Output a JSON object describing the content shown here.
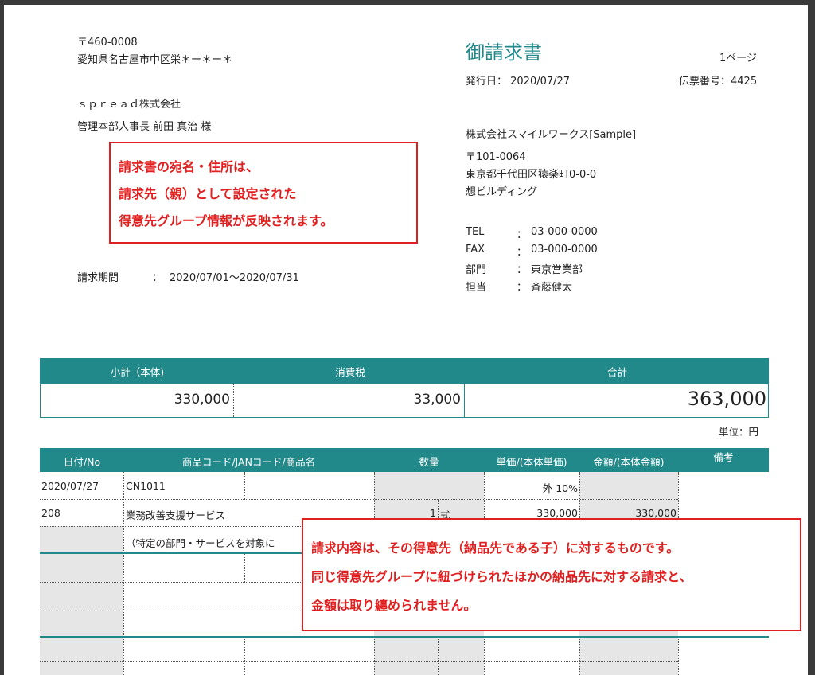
{
  "recipient": {
    "postal": "〒460-0008",
    "address": "愛知県名古屋市中区栄＊ー＊ー＊",
    "company": "ｓｐｒｅａｄ株式会社",
    "person": "管理本部人事長 前田 真治 様"
  },
  "header": {
    "title": "御請求書",
    "page": "1ページ",
    "issue_date": "発行日： 2020/07/27",
    "slip_no": "伝票番号：4425"
  },
  "issuer": {
    "company": "株式会社スマイルワークス[Sample]",
    "postal": "〒101-0064",
    "address": "東京都千代田区猿楽町0-0-0",
    "building": "想ビルディング",
    "rows": [
      {
        "label": "TEL",
        "sep": "：",
        "value": "03-000-0000"
      },
      {
        "label": "FAX",
        "sep": "：",
        "value": "03-000-0000"
      },
      {
        "label": "部門",
        "sep": "：",
        "value": "東京営業部"
      },
      {
        "label": "担当",
        "sep": "：",
        "value": "斉藤健太"
      }
    ]
  },
  "period": {
    "label": "請求期間",
    "sep": "：",
    "value": "2020/07/01〜2020/07/31"
  },
  "callout1": {
    "lines": [
      "請求書の宛名・住所は、",
      "請求先（親）として設定された",
      "得意先グループ情報が反映されます。"
    ]
  },
  "totals": {
    "headers": [
      "小計（本体)",
      "消費税",
      "合計"
    ],
    "values": [
      "330,000",
      "33,000",
      "363,000"
    ],
    "unit": "単位：円"
  },
  "table": {
    "headers": [
      "日付/No",
      "商品コード/JANコード/商品名",
      "数量",
      "単価/(本体単価)",
      "金額/(本体金額)",
      "備考"
    ],
    "row1": {
      "date": "2020/07/27",
      "code": "CN1011",
      "tax": "外 10%"
    },
    "row2": {
      "no": "208",
      "name": "業務改善支援サービス",
      "qty": "1",
      "unit": "式",
      "price": "330,000",
      "amount": "330,000"
    },
    "row3": {
      "note": "（特定の部門・サービスを対象に"
    }
  },
  "callout2": {
    "lines": [
      "請求内容は、その得意先（納品先である子）に対するものです。",
      "同じ得意先グループに紐づけられたほかの納品先に対する請求と、",
      "金額は取り纏められません。"
    ]
  },
  "colors": {
    "accent": "#21898a",
    "callout": "#e02020"
  }
}
